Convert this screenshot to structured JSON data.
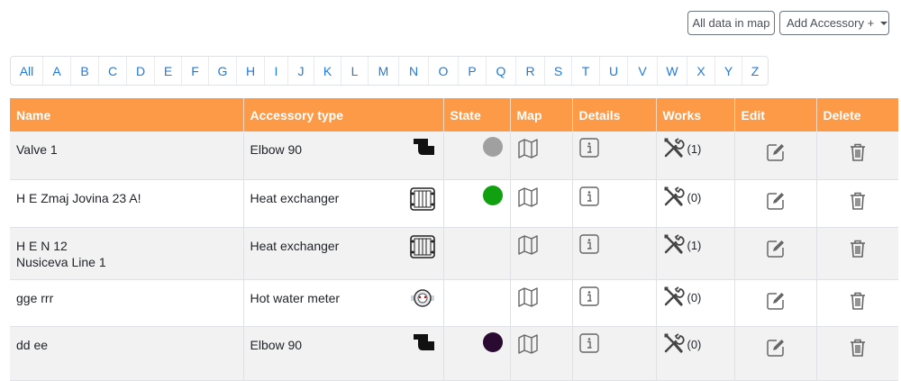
{
  "toolbar": {
    "all_data_label": "All data in map",
    "add_accessory_label": "Add Accessory +"
  },
  "alphabet": [
    "All",
    "A",
    "B",
    "C",
    "D",
    "E",
    "F",
    "G",
    "H",
    "I",
    "J",
    "K",
    "L",
    "M",
    "N",
    "O",
    "P",
    "Q",
    "R",
    "S",
    "T",
    "U",
    "V",
    "W",
    "X",
    "Y",
    "Z"
  ],
  "table": {
    "headers": {
      "name": "Name",
      "type": "Accessory type",
      "state": "State",
      "map": "Map",
      "details": "Details",
      "works": "Works",
      "edit": "Edit",
      "delete": "Delete"
    },
    "rows": [
      {
        "name": "Valve 1",
        "name2": "",
        "type": "Elbow 90",
        "type_icon": "elbow-icon",
        "state_color": "#a0a0a0",
        "works": "(1)"
      },
      {
        "name": "H E Zmaj Jovina 23 A!",
        "name2": "",
        "type": "Heat exchanger",
        "type_icon": "heat-exchanger-icon",
        "state_color": "#10a010",
        "works": "(0)"
      },
      {
        "name": "H E N 12",
        "name2": "Nusiceva Line 1",
        "type": "Heat exchanger",
        "type_icon": "heat-exchanger-icon",
        "state_color": "",
        "works": "(1)"
      },
      {
        "name": "gge rrr",
        "name2": "",
        "type": "Hot water meter",
        "type_icon": "water-meter-icon",
        "state_color": "",
        "works": "(0)"
      },
      {
        "name": "dd ee",
        "name2": "",
        "type": "Elbow 90",
        "type_icon": "elbow-icon",
        "state_color": "#2a0a30",
        "works": "(0)"
      }
    ]
  }
}
